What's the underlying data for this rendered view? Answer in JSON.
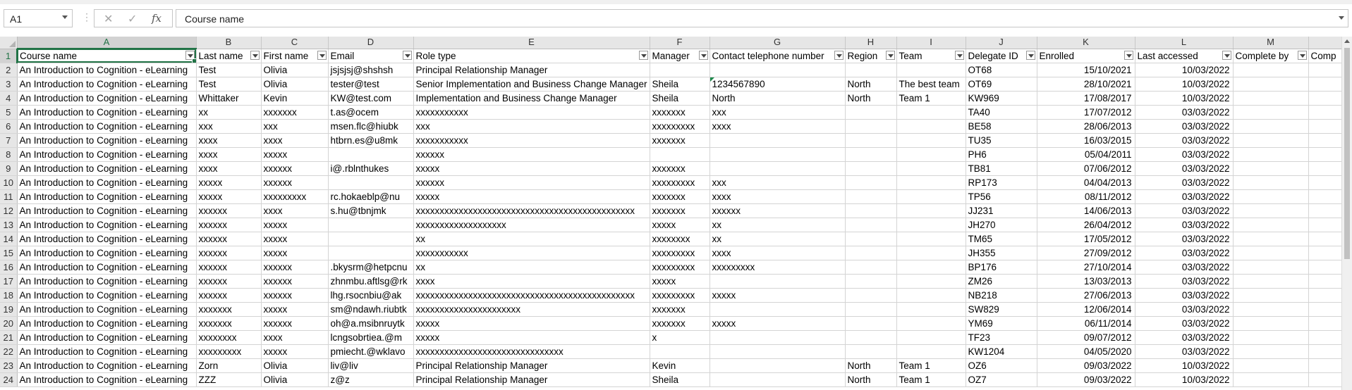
{
  "formula_bar": {
    "name_box": "A1",
    "cancel_icon": "close-icon",
    "enter_icon": "check-icon",
    "fx_label": "fx",
    "formula": "Course name"
  },
  "column_letters": [
    "A",
    "B",
    "C",
    "D",
    "E",
    "F",
    "G",
    "H",
    "I",
    "J",
    "K",
    "L",
    "M",
    ""
  ],
  "row_numbers": [
    "1",
    "2",
    "3",
    "4",
    "5",
    "6",
    "7",
    "8",
    "9",
    "10",
    "11",
    "12",
    "13",
    "14",
    "15",
    "16",
    "17",
    "18",
    "19",
    "20",
    "21",
    "22",
    "23",
    "24"
  ],
  "headers": [
    "Course name",
    "Last name",
    "First name",
    "Email",
    "Role type",
    "Manager",
    "Contact telephone number",
    "Region",
    "Team",
    "Delegate ID",
    "Enrolled",
    "Last accessed",
    "Complete by",
    "Comp"
  ],
  "rows": [
    [
      "An Introduction to Cognition - eLearning",
      "Test",
      "Olivia",
      "jsjsjsj@shshsh",
      "Principal Relationship Manager",
      "",
      "",
      "",
      "",
      "OT68",
      "15/10/2021",
      "10/03/2022",
      "",
      ""
    ],
    [
      "An Introduction to Cognition - eLearning",
      "Test",
      "Olivia",
      "tester@test",
      "Senior Implementation and Business Change Manager",
      "Sheila",
      "1234567890",
      "North",
      "The best team",
      "OT69",
      "28/10/2021",
      "10/03/2022",
      "",
      ""
    ],
    [
      "An Introduction to Cognition - eLearning",
      "Whittaker",
      "Kevin",
      "KW@test.com",
      "Implementation and Business Change Manager",
      "Sheila",
      "North",
      "North",
      "Team 1",
      "KW969",
      "17/08/2017",
      "10/03/2022",
      "",
      ""
    ],
    [
      "An Introduction to Cognition - eLearning",
      "xx",
      "xxxxxxx",
      "t.as@ocem",
      "xxxxxxxxxxx",
      "xxxxxxx",
      "xxx",
      "",
      "",
      "TA40",
      "17/07/2012",
      "03/03/2022",
      "",
      ""
    ],
    [
      "An Introduction to Cognition - eLearning",
      "xxx",
      "xxx",
      "msen.flc@hiubk",
      "xxx",
      "xxxxxxxxx",
      "xxxx",
      "",
      "",
      "BE58",
      "28/06/2013",
      "03/03/2022",
      "",
      ""
    ],
    [
      "An Introduction to Cognition - eLearning",
      "xxxx",
      "xxxx",
      "htbrn.es@u8mk",
      "xxxxxxxxxxx",
      "xxxxxxx",
      "",
      "",
      "",
      "TU35",
      "16/03/2015",
      "03/03/2022",
      "",
      ""
    ],
    [
      "An Introduction to Cognition - eLearning",
      "xxxx",
      "xxxxx",
      "",
      "xxxxxx",
      "",
      "",
      "",
      "",
      "PH6",
      "05/04/2011",
      "03/03/2022",
      "",
      ""
    ],
    [
      "An Introduction to Cognition - eLearning",
      "xxxx",
      "xxxxxx",
      "i@.rblnthukes",
      "xxxxx",
      "xxxxxxx",
      "",
      "",
      "",
      "TB81",
      "07/06/2012",
      "03/03/2022",
      "",
      ""
    ],
    [
      "An Introduction to Cognition - eLearning",
      "xxxxx",
      "xxxxxx",
      "",
      "xxxxxx",
      "xxxxxxxxx",
      "xxx",
      "",
      "",
      "RP173",
      "04/04/2013",
      "03/03/2022",
      "",
      ""
    ],
    [
      "An Introduction to Cognition - eLearning",
      "xxxxx",
      "xxxxxxxxx",
      "rc.hokaeblp@nu",
      "xxxxx",
      "xxxxxxx",
      "xxxx",
      "",
      "",
      "TP56",
      "08/11/2012",
      "03/03/2022",
      "",
      ""
    ],
    [
      "An Introduction to Cognition - eLearning",
      "xxxxxx",
      "xxxx",
      "s.hu@tbnjmk",
      "xxxxxxxxxxxxxxxxxxxxxxxxxxxxxxxxxxxxxxxxxxxxxx",
      "xxxxxxx",
      "xxxxxx",
      "",
      "",
      "JJ231",
      "14/06/2013",
      "03/03/2022",
      "",
      ""
    ],
    [
      "An Introduction to Cognition - eLearning",
      "xxxxxx",
      "xxxxx",
      "",
      "xxxxxxxxxxxxxxxxxxx",
      "xxxxx",
      "xx",
      "",
      "",
      "JH270",
      "26/04/2012",
      "03/03/2022",
      "",
      ""
    ],
    [
      "An Introduction to Cognition - eLearning",
      "xxxxxx",
      "xxxxx",
      "",
      "xx",
      "xxxxxxxx",
      "xx",
      "",
      "",
      "TM65",
      "17/05/2012",
      "03/03/2022",
      "",
      ""
    ],
    [
      "An Introduction to Cognition - eLearning",
      "xxxxxx",
      "xxxxx",
      "",
      "xxxxxxxxxxx",
      "xxxxxxxxx",
      "xxxx",
      "",
      "",
      "JH355",
      "27/09/2012",
      "03/03/2022",
      "",
      ""
    ],
    [
      "An Introduction to Cognition - eLearning",
      "xxxxxx",
      "xxxxxx",
      ".bkysrm@hetpcnu",
      "xx",
      "xxxxxxxxx",
      "xxxxxxxxx",
      "",
      "",
      "BP176",
      "27/10/2014",
      "03/03/2022",
      "",
      ""
    ],
    [
      "An Introduction to Cognition - eLearning",
      "xxxxxx",
      "xxxxxx",
      "zhnmbu.aftlsg@rk",
      "xxxx",
      "xxxxx",
      "",
      "",
      "",
      "ZM26",
      "13/03/2013",
      "03/03/2022",
      "",
      ""
    ],
    [
      "An Introduction to Cognition - eLearning",
      "xxxxxx",
      "xxxxxx",
      "lhg.rsocnbiu@ak",
      "xxxxxxxxxxxxxxxxxxxxxxxxxxxxxxxxxxxxxxxxxxxxxx",
      "xxxxxxxxx",
      "xxxxx",
      "",
      "",
      "NB218",
      "27/06/2013",
      "03/03/2022",
      "",
      ""
    ],
    [
      "An Introduction to Cognition - eLearning",
      "xxxxxxx",
      "xxxxx",
      "sm@ndawh.riubtk",
      "xxxxxxxxxxxxxxxxxxxxxx",
      "xxxxxxx",
      "",
      "",
      "",
      "SW829",
      "12/06/2014",
      "03/03/2022",
      "",
      ""
    ],
    [
      "An Introduction to Cognition - eLearning",
      "xxxxxxx",
      "xxxxxx",
      "oh@a.msibnruytk",
      "xxxxx",
      "xxxxxxx",
      "xxxxx",
      "",
      "",
      "YM69",
      "06/11/2014",
      "03/03/2022",
      "",
      ""
    ],
    [
      "An Introduction to Cognition - eLearning",
      "xxxxxxxx",
      "xxxx",
      "lcngsobrtiea.@m",
      "xxxxx",
      "x",
      "",
      "",
      "",
      "TF23",
      "09/07/2012",
      "03/03/2022",
      "",
      ""
    ],
    [
      "An Introduction to Cognition - eLearning",
      "xxxxxxxxx",
      "xxxxx",
      "pmiecht.@wklavo",
      "xxxxxxxxxxxxxxxxxxxxxxxxxxxxxxx",
      "",
      "",
      "",
      "",
      "KW1204",
      "04/05/2020",
      "03/03/2022",
      "",
      ""
    ],
    [
      "An Introduction to Cognition - eLearning",
      "Zorn",
      "Olivia",
      "liv@liv",
      "Principal Relationship Manager",
      "Kevin",
      "",
      "North",
      "Team 1",
      "OZ6",
      "09/03/2022",
      "10/03/2022",
      "",
      ""
    ],
    [
      "An Introduction to Cognition - eLearning",
      "ZZZ",
      "Olivia",
      "z@z",
      "Principal Relationship Manager",
      "Sheila",
      "",
      "North",
      "Team 1",
      "OZ7",
      "09/03/2022",
      "10/03/2022",
      "",
      ""
    ]
  ]
}
